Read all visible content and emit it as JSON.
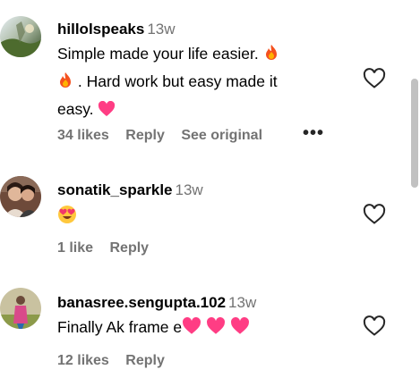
{
  "comments": [
    {
      "username": "hillolspeaks",
      "time": "13w",
      "text_line1": "Simple made your life easier.",
      "text_line2": ". Hard work but easy made it",
      "text_line3": "easy.",
      "likes": "34 likes",
      "reply": "Reply",
      "see_original": "See original",
      "more": "•••"
    },
    {
      "username": "sonatik_sparkle",
      "time": "13w",
      "likes": "1 like",
      "reply": "Reply"
    },
    {
      "username": "banasree.sengupta.102",
      "time": "13w",
      "text": "Finally Ak frame e",
      "likes": "12 likes",
      "reply": "Reply"
    }
  ],
  "icons": {
    "like": "heart-outline-icon",
    "fire": "fire-emoji",
    "pink_heart": "pink-heart-emoji",
    "heart_eyes": "heart-eyes-emoji"
  },
  "colors": {
    "muted": "#737373",
    "pink": "#ff3d84"
  }
}
